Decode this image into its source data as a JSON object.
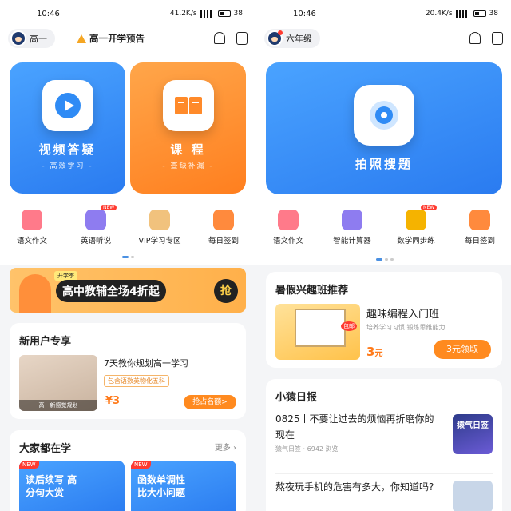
{
  "left": {
    "status": {
      "time": "10:46",
      "speed": "41.2K/s",
      "battery": "38"
    },
    "grade": "高一",
    "notice": "高一开学预告",
    "hero": [
      {
        "title": "视频答疑",
        "sub": "- 高效学习 -"
      },
      {
        "title": "课 程",
        "sub": "- 查缺补漏 -"
      }
    ],
    "quick": [
      {
        "label": "语文作文",
        "color": "#ff7a8a"
      },
      {
        "label": "英语听说",
        "color": "#8e7cf0",
        "badge": "NEW"
      },
      {
        "label": "VIP学习专区",
        "color": "#f1c27d"
      },
      {
        "label": "每日签到",
        "color": "#ff8a3d"
      }
    ],
    "banner": {
      "tag": "开学季",
      "text": "高中教辅全场4折起",
      "action": "抢"
    },
    "newuser": {
      "title": "新用户专享",
      "course": "7天教你规划高一学习",
      "tag": "包含语数英物化五科",
      "thumb_caption": "高一新感觉规划",
      "price": "¥3",
      "action": "抢占名额>"
    },
    "popular": {
      "title": "大家都在学",
      "more": "更多",
      "items": [
        {
          "badge": "NEW",
          "text": "读后续写 高分句大赏"
        },
        {
          "badge": "NEW",
          "text": "函数单调性 比大小问题"
        }
      ]
    }
  },
  "right": {
    "status": {
      "time": "10:46",
      "speed": "20.4K/s",
      "battery": "38"
    },
    "grade": "六年级",
    "hero": {
      "title": "拍照搜题"
    },
    "quick": [
      {
        "label": "语文作文",
        "color": "#ff7a8a"
      },
      {
        "label": "智能计算器",
        "color": "#8e7cf0"
      },
      {
        "label": "数学同步练",
        "color": "#f5b300",
        "badge": "NEW"
      },
      {
        "label": "每日签到",
        "color": "#ff8a3d"
      }
    ],
    "interest": {
      "title": "暑假兴趣班推荐",
      "course": "趣味编程入门班",
      "desc": "培养学习习惯 锻炼思维能力",
      "price": "3",
      "unit": "元",
      "action": "3元领取",
      "thumb_tag": "包邮"
    },
    "daily": {
      "title": "小猿日报",
      "items": [
        {
          "text": "0825丨不要让过去的烦恼再折磨你的现在",
          "source": "猿气日签",
          "views": "6942 浏览",
          "thumb": "猿气日签"
        },
        {
          "text": "熬夜玩手机的危害有多大，你知道吗?"
        }
      ]
    }
  }
}
